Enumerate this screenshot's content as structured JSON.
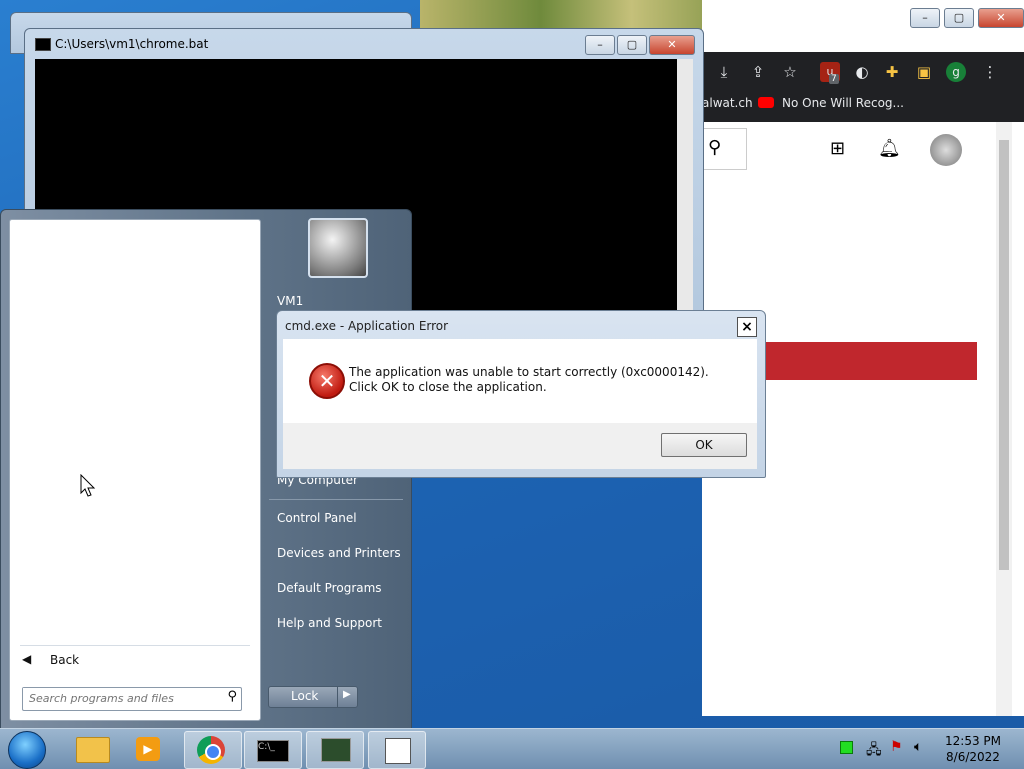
{
  "cmd_window": {
    "title": "C:\\Users\\vm1\\chrome.bat"
  },
  "chrome_window": {
    "bookmarks": [
      {
        "label": "alwat.ch"
      },
      {
        "label": "No One Will Recog..."
      }
    ],
    "extension_badge": "7",
    "profile_initial": "g"
  },
  "start_menu": {
    "user_name": "VM1",
    "right_items": [
      "My Computer",
      "Control Panel",
      "Devices and Printers",
      "Default Programs",
      "Help and Support"
    ],
    "back_label": "Back",
    "search_placeholder": "Search programs and files",
    "lock_label": "Lock"
  },
  "dialog": {
    "title": "cmd.exe - Application Error",
    "message": "The application was unable to start correctly (0xc0000142). Click OK to close the application.",
    "ok_label": "OK",
    "close_label": "×"
  },
  "taskbar": {
    "time": "12:53 PM",
    "date": "8/6/2022"
  },
  "colors": {
    "error_red": "#c01a10",
    "chrome_red_bar": "#c0272d",
    "console_bg": "#000000"
  }
}
